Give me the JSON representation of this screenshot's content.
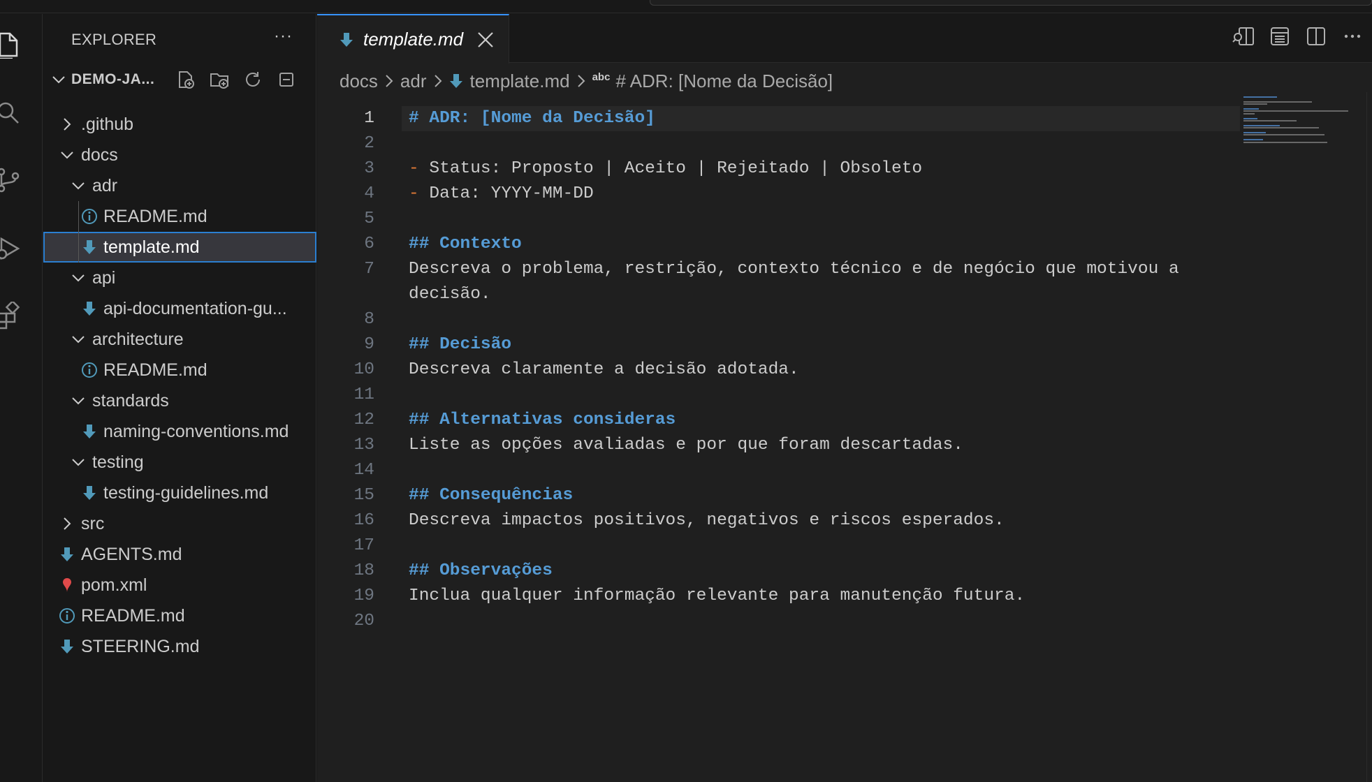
{
  "sidebar": {
    "title": "EXPLORER",
    "more": "···",
    "project": "DEMO-JA...",
    "tree": [
      {
        "label": ".github",
        "depth": 0,
        "kind": "folder",
        "open": false
      },
      {
        "label": "docs",
        "depth": 0,
        "kind": "folder",
        "open": true
      },
      {
        "label": "adr",
        "depth": 1,
        "kind": "folder",
        "open": true
      },
      {
        "label": "README.md",
        "depth": 2,
        "kind": "info"
      },
      {
        "label": "template.md",
        "depth": 2,
        "kind": "md",
        "selected": true
      },
      {
        "label": "api",
        "depth": 1,
        "kind": "folder",
        "open": true
      },
      {
        "label": "api-documentation-gu...",
        "depth": 2,
        "kind": "md"
      },
      {
        "label": "architecture",
        "depth": 1,
        "kind": "folder",
        "open": true
      },
      {
        "label": "README.md",
        "depth": 2,
        "kind": "info"
      },
      {
        "label": "standards",
        "depth": 1,
        "kind": "folder",
        "open": true
      },
      {
        "label": "naming-conventions.md",
        "depth": 2,
        "kind": "md"
      },
      {
        "label": "testing",
        "depth": 1,
        "kind": "folder",
        "open": true
      },
      {
        "label": "testing-guidelines.md",
        "depth": 2,
        "kind": "md"
      },
      {
        "label": "src",
        "depth": 0,
        "kind": "folder",
        "open": false
      },
      {
        "label": "AGENTS.md",
        "depth": 0,
        "kind": "md"
      },
      {
        "label": "pom.xml",
        "depth": 0,
        "kind": "xml"
      },
      {
        "label": "README.md",
        "depth": 0,
        "kind": "info"
      },
      {
        "label": "STEERING.md",
        "depth": 0,
        "kind": "md"
      }
    ]
  },
  "editor": {
    "tab_label": "template.md",
    "breadcrumb": {
      "parts": [
        "docs",
        "adr",
        "template.md"
      ],
      "symbol_badge": "abc",
      "symbol": "# ADR: [Nome da Decisão]"
    },
    "current_line": 1,
    "lines": [
      {
        "n": "1",
        "type": "heading",
        "text": "# ADR: [Nome da Decisão]"
      },
      {
        "n": "2",
        "type": "blank",
        "text": ""
      },
      {
        "n": "3",
        "type": "bullet",
        "mark": "-",
        "text": " Status: Proposto | Aceito | Rejeitado | Obsoleto"
      },
      {
        "n": "4",
        "type": "bullet",
        "mark": "-",
        "text": " Data: YYYY-MM-DD"
      },
      {
        "n": "5",
        "type": "blank",
        "text": ""
      },
      {
        "n": "6",
        "type": "heading",
        "text": "## Contexto"
      },
      {
        "n": "7",
        "type": "text",
        "text": "Descreva o problema, restrição, contexto técnico e de negócio que motivou a"
      },
      {
        "n": "",
        "type": "text",
        "text": "decisão."
      },
      {
        "n": "8",
        "type": "blank",
        "text": ""
      },
      {
        "n": "9",
        "type": "heading",
        "text": "## Decisão"
      },
      {
        "n": "10",
        "type": "text",
        "text": "Descreva claramente a decisão adotada."
      },
      {
        "n": "11",
        "type": "blank",
        "text": ""
      },
      {
        "n": "12",
        "type": "heading",
        "text": "## Alternativas consideras"
      },
      {
        "n": "13",
        "type": "text",
        "text": "Liste as opções avaliadas e por que foram descartadas."
      },
      {
        "n": "14",
        "type": "blank",
        "text": ""
      },
      {
        "n": "15",
        "type": "heading",
        "text": "## Consequências"
      },
      {
        "n": "16",
        "type": "text",
        "text": "Descreva impactos positivos, negativos e riscos esperados."
      },
      {
        "n": "17",
        "type": "blank",
        "text": ""
      },
      {
        "n": "18",
        "type": "heading",
        "text": "## Observações"
      },
      {
        "n": "19",
        "type": "text",
        "text": "Inclua qualquer informação relevante para manutenção futura."
      },
      {
        "n": "20",
        "type": "blank",
        "text": ""
      }
    ]
  },
  "icons": {
    "activity": [
      "files-icon",
      "search-icon",
      "source-control-icon",
      "run-debug-icon",
      "extensions-icon"
    ],
    "project_actions": [
      "new-file-icon",
      "new-folder-icon",
      "refresh-icon",
      "collapse-all-icon"
    ],
    "editor_actions": [
      "open-preview-icon",
      "layout-icon",
      "split-editor-icon",
      "more-actions-icon"
    ]
  },
  "colors": {
    "accent": "#3794ff",
    "markdown_icon": "#519aba",
    "heading": "#569cd6",
    "bullet": "#e07a36",
    "xml_icon": "#e04a4a"
  }
}
